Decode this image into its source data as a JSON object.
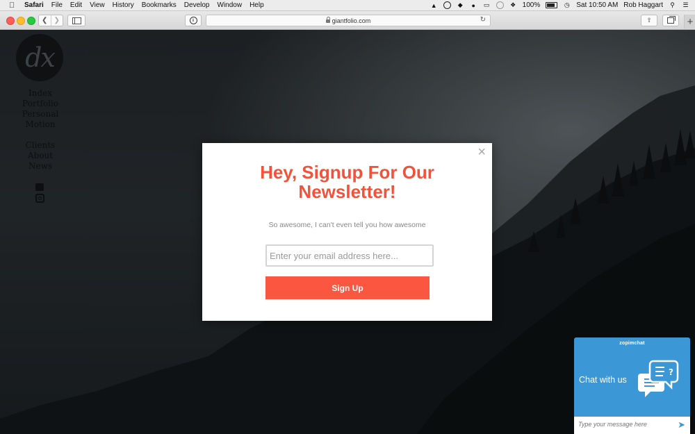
{
  "menubar": {
    "app_name": "Safari",
    "menus": [
      "File",
      "Edit",
      "View",
      "History",
      "Bookmarks",
      "Develop",
      "Window",
      "Help"
    ],
    "battery": "100%",
    "clock": "Sat 10:50 AM",
    "user": "Rob Haggart"
  },
  "browser": {
    "url": "giantfolio.com"
  },
  "site": {
    "logo_text": "dx",
    "nav_primary": [
      "Index",
      "Portfolio",
      "Personal",
      "Motion"
    ],
    "nav_secondary": [
      "Clients",
      "About",
      "News"
    ]
  },
  "modal": {
    "close": "×",
    "title_line1": "Hey, Signup For Our",
    "title_line2": "Newsletter!",
    "subtitle": "So awesome, I can't even tell you how awesome",
    "email_placeholder": "Enter your email address here...",
    "button": "Sign Up",
    "accent_color": "#f2523a"
  },
  "chat": {
    "brand": "zopimchat",
    "title": "Chat with us",
    "input_placeholder": "Type your message here",
    "color": "#3b97d6"
  }
}
